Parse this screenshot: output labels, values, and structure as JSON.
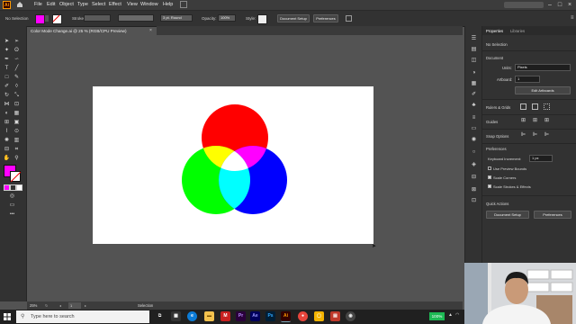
{
  "menubar": {
    "logo": "Ai",
    "items": [
      "File",
      "Edit",
      "Object",
      "Type",
      "Select",
      "Effect",
      "View",
      "Window",
      "Help"
    ]
  },
  "controlbar": {
    "selection": "No Selection",
    "stroke_label": "Stroke:",
    "brush": "3 pt. Round",
    "opacity_label": "Opacity:",
    "opacity_value": "100%",
    "style_label": "Style:",
    "doc_setup": "Document Setup",
    "preferences": "Preferences"
  },
  "document": {
    "tab_title": "Color Mode Change.ai @ 25 % (RGB/CPU Preview)"
  },
  "panel": {
    "tabs": [
      "Properties",
      "Libraries"
    ],
    "no_selection": "No Selection",
    "document_heading": "Document",
    "units_label": "Units:",
    "units_value": "Pixels",
    "artboard_label": "Artboard:",
    "artboard_value": "1",
    "edit_artboards": "Edit Artboards",
    "rulers_grids": "Rulers & Grids",
    "guides": "Guides",
    "snap_options": "Snap Options",
    "preferences_heading": "Preferences",
    "keyboard_increment_label": "Keyboard Increment:",
    "keyboard_increment_value": "1 px",
    "use_preview_bounds": "Use Preview Bounds",
    "scale_corners": "Scale Corners",
    "scale_strokes": "Scale Strokes & Effects",
    "quick_actions": "Quick Actions",
    "doc_setup": "Document Setup",
    "preferences_btn": "Preferences"
  },
  "statusbar": {
    "zoom": "25%",
    "artboard": "1",
    "tool": "Selection"
  },
  "taskbar": {
    "search_placeholder": "Type here to search",
    "battery": "100%"
  },
  "colors": {
    "fill": "#ff00ff",
    "red": "#ff0000",
    "green": "#00ff00",
    "blue": "#0000ff"
  }
}
